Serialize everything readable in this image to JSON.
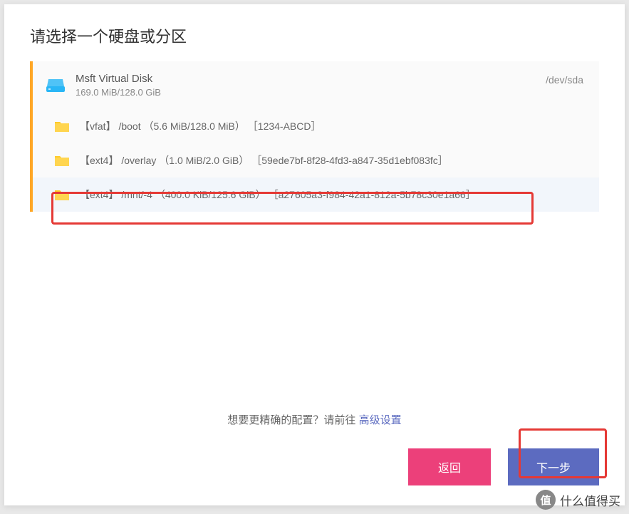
{
  "dialog": {
    "title": "请选择一个硬盘或分区"
  },
  "disk": {
    "name": "Msft Virtual Disk",
    "size": "169.0 MiB/128.0 GiB",
    "device": "/dev/sda"
  },
  "partitions": [
    {
      "fs": "【vfat】",
      "mount": "/boot",
      "size": "（5.6 MiB/128.0 MiB）",
      "uuid": "［1234-ABCD］"
    },
    {
      "fs": "【ext4】",
      "mount": "/overlay",
      "size": "（1.0 MiB/2.0 GiB）",
      "uuid": "［59ede7bf-8f28-4fd3-a847-35d1ebf083fc］"
    },
    {
      "fs": "【ext4】",
      "mount": "/mnt/-4",
      "size": "（400.0 KiB/125.6 GiB）",
      "uuid": "［a27605a3-f984-42a1-812a-5b78c30e1a66］"
    }
  ],
  "footer": {
    "prompt": "想要更精确的配置？请前往 ",
    "link": "高级设置"
  },
  "buttons": {
    "back": "返回",
    "next": "下一步"
  },
  "watermark": {
    "badge": "值",
    "text": "什么值得买"
  }
}
